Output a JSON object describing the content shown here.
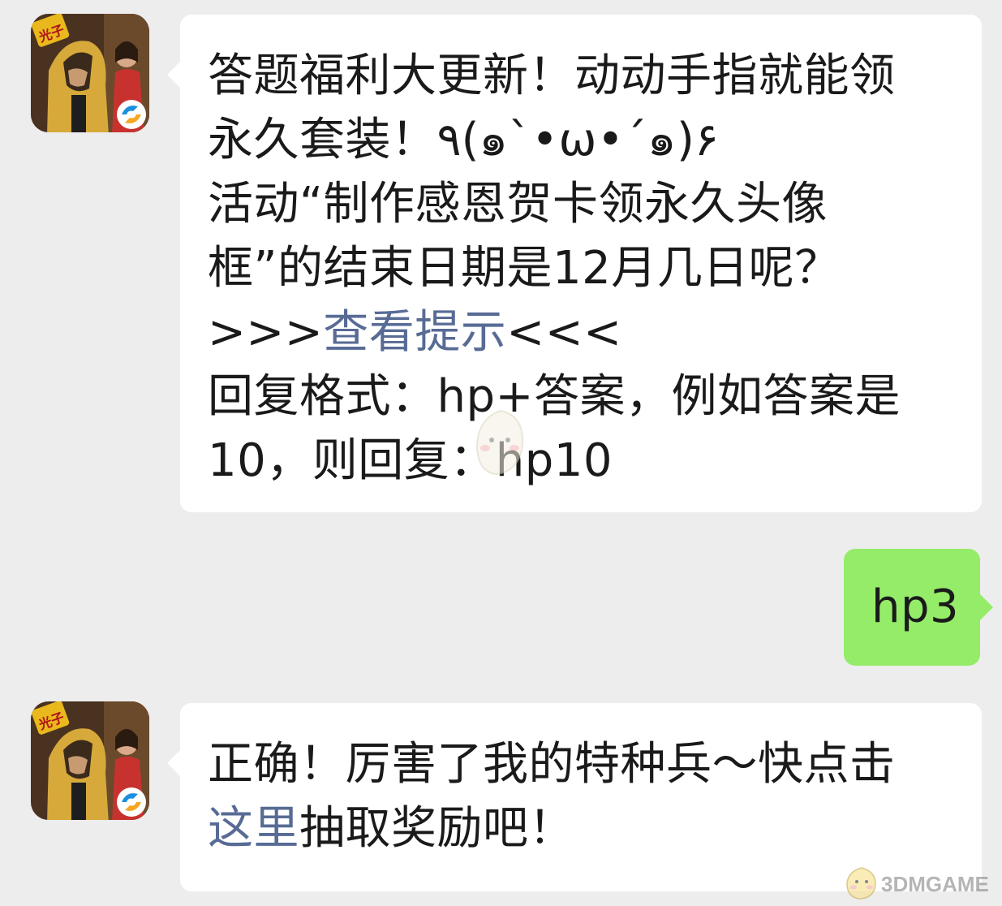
{
  "messages": {
    "first": {
      "line1": "答题福利大更新！动动手指就能领",
      "line2": "永久套装！٩(๑`•ω•´๑)۶",
      "line3": "活动“制作感恩贺卡领永久头像",
      "line4": "框”的结束日期是12月几日呢？",
      "hint_prefix": ">>>",
      "hint_link": "查看提示",
      "hint_suffix": "<<<",
      "line6": "回复格式：hp+答案，例如答案是",
      "line7": "10，则回复：hp10"
    },
    "reply": {
      "text": "hp3"
    },
    "second": {
      "line1": "正确！厉害了我的特种兵～快点击",
      "link": "这里",
      "line2_rest": "抽取奖励吧！"
    }
  },
  "avatar": {
    "badge_text": "光子"
  },
  "watermark": {
    "text": "3DMGAME"
  },
  "colors": {
    "background": "#ededed",
    "bubble_incoming": "#ffffff",
    "bubble_outgoing": "#95ec69",
    "link": "#576b95"
  }
}
